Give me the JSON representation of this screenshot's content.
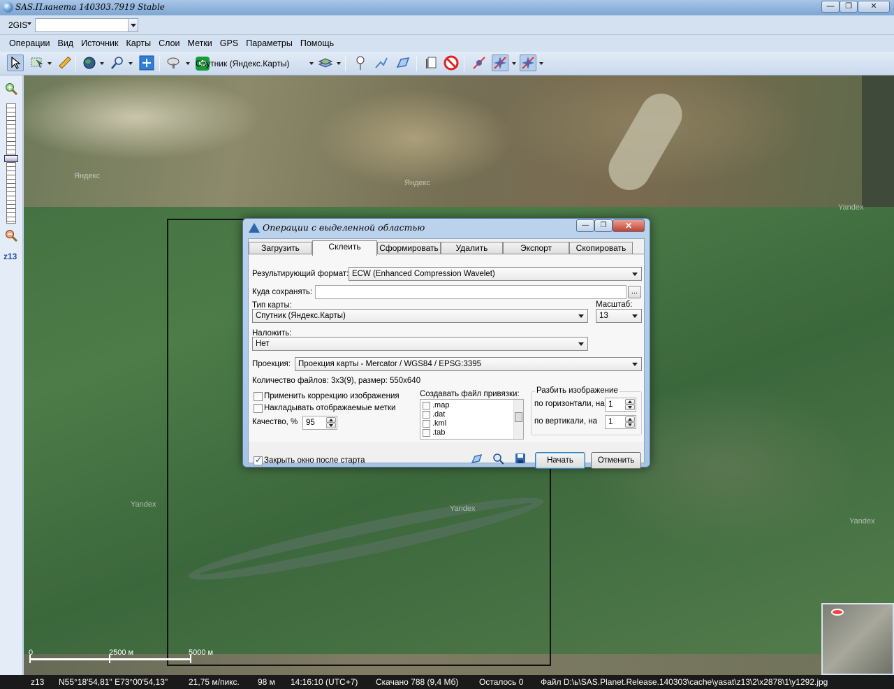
{
  "window": {
    "title": "SAS.Планета 140303.7919 Stable",
    "min_label": "—",
    "max_label": "❐",
    "close_label": "✕"
  },
  "search": {
    "engine": "2GIS",
    "value": ""
  },
  "menu": [
    "Операции",
    "Вид",
    "Источник",
    "Карты",
    "Слои",
    "Метки",
    "GPS",
    "Параметры",
    "Помощь"
  ],
  "toolbar": {
    "map_type_label": "Спутник (Яндекс.Карты)",
    "map_type_icon": "Ф"
  },
  "zoom": {
    "level_label": "z13"
  },
  "map": {
    "watermark": "Yandex",
    "watermark_ru": "Яндекс"
  },
  "scale": {
    "zero": "0",
    "mid": "2500 м",
    "end": "5000 м"
  },
  "status": {
    "zoom": "z13",
    "coords": "N55°18'54,81\" E73°00'54,13\"",
    "resolution": "21,75 м/пикс.",
    "altitude": "98 м",
    "time": "14:16:10 (UTC+7)",
    "downloaded": "Скачано 788 (9,4 Мб)",
    "remaining": "Осталось 0",
    "file": "Файл D:\\ь\\SAS.Planet.Release.140303\\cache\\yasat\\z13\\2\\x2878\\1\\y1292.jpg"
  },
  "dialog": {
    "title": "Операции с выделенной областью",
    "tabs": [
      "Загрузить",
      "Склеить",
      "Сформировать",
      "Удалить",
      "Экспорт",
      "Скопировать"
    ],
    "active_tab": "Склеить",
    "format_label": "Результирующий формат:",
    "format_value": "ECW (Enhanced Compression Wavelet)",
    "save_to_label": "Куда сохранять:",
    "save_to_value": "",
    "browse_label": "...",
    "map_type_label": "Тип карты:",
    "map_type_value": "Спутник (Яндекс.Карты)",
    "scale_label": "Масштаб:",
    "scale_value": "13",
    "overlay_label": "Наложить:",
    "overlay_value": "Нет",
    "projection_label": "Проекция:",
    "projection_value": "Проекция карты - Mercator / WGS84 / EPSG:3395",
    "file_count": "Количество файлов: 3х3(9), размер: 550х640",
    "apply_correction": "Применить коррекцию изображения",
    "apply_correction_checked": false,
    "overlay_marks": "Накладывать отображаемые метки",
    "overlay_marks_checked": false,
    "quality_label": "Качество, %",
    "quality_value": "95",
    "georef_label": "Создавать файл привязки:",
    "georef_items": [
      {
        "label": ".map",
        "checked": false
      },
      {
        "label": ".dat",
        "checked": false
      },
      {
        "label": ".kml",
        "checked": false
      },
      {
        "label": ".tab",
        "checked": false
      }
    ],
    "split_title": "Разбить изображение",
    "split_h_label": "по горизонтали, на",
    "split_h_value": "1",
    "split_v_label": "по вертикали, на",
    "split_v_value": "1",
    "close_after_start": "Закрыть окно после старта",
    "close_after_start_checked": true,
    "start_label": "Начать",
    "cancel_label": "Отменить"
  }
}
